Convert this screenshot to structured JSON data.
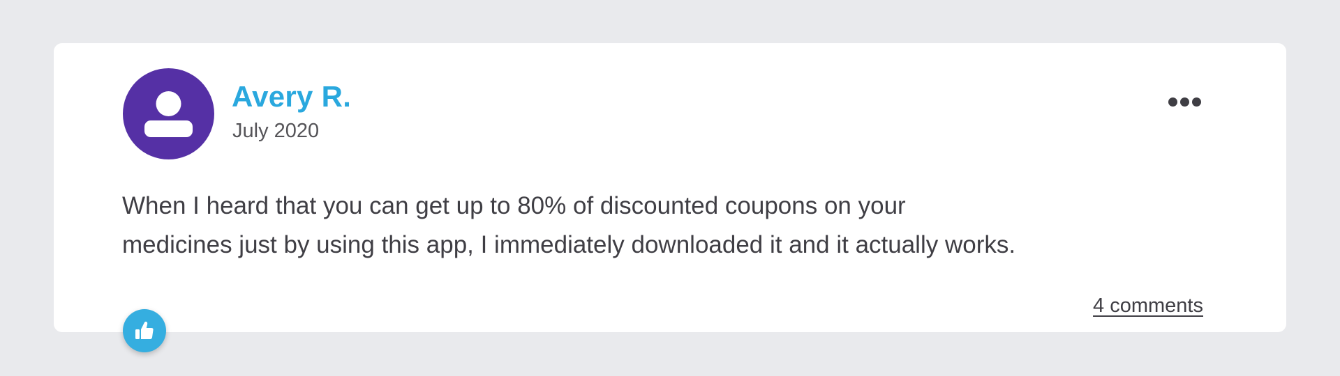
{
  "colors": {
    "page_background": "#e9eaed",
    "card_background": "#ffffff",
    "avatar_background": "#5530a5",
    "author_name": "#2aa8de",
    "like_button": "#35aee0",
    "text_primary": "#3f3e44"
  },
  "review": {
    "author": "Avery R.",
    "date": "July 2020",
    "text_line1": "When I heard that you can get up to 80% of discounted coupons on your",
    "text_line2": "medicines just by using this app, I immediately downloaded it and it actually works.",
    "comments_label": "4 comments"
  },
  "icons": {
    "avatar": "user-silhouette-icon",
    "more": "ellipsis-icon",
    "like": "thumbs-up-icon"
  }
}
